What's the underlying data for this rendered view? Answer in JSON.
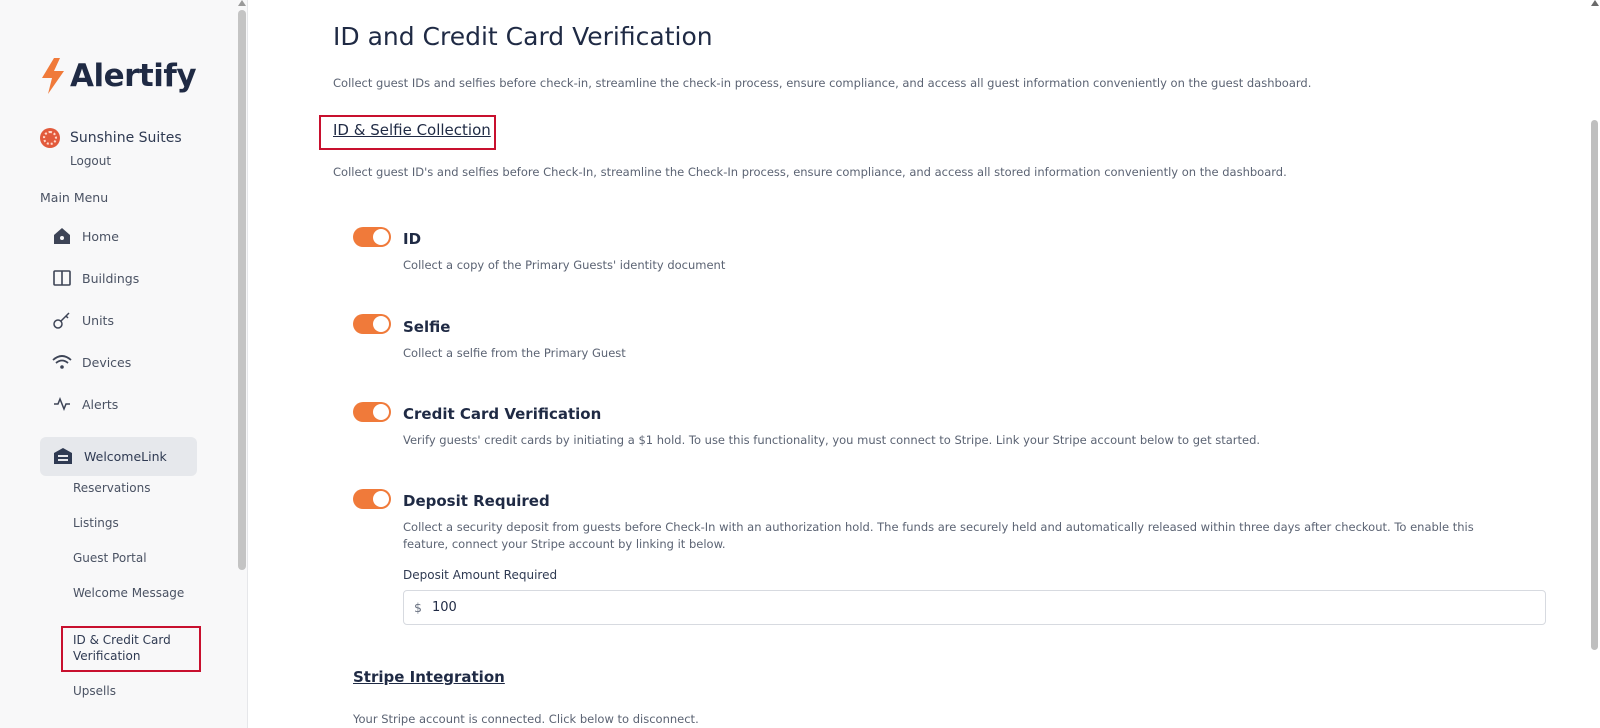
{
  "brand": {
    "name": "Alertify",
    "accent": "#f07a3a",
    "text": "#1f2a44",
    "highlight": "#c8102e"
  },
  "property": {
    "name": "Sunshine Suites",
    "logout": "Logout"
  },
  "sidebar": {
    "menu_title": "Main Menu",
    "items": [
      {
        "label": "Home",
        "icon": "home-icon"
      },
      {
        "label": "Buildings",
        "icon": "book-icon"
      },
      {
        "label": "Units",
        "icon": "key-icon"
      },
      {
        "label": "Devices",
        "icon": "wifi-icon"
      },
      {
        "label": "Alerts",
        "icon": "activity-icon"
      }
    ],
    "active": {
      "label": "WelcomeLink",
      "icon": "building-icon"
    },
    "sub_items": [
      {
        "label": "Reservations"
      },
      {
        "label": "Listings"
      },
      {
        "label": "Guest Portal"
      },
      {
        "label": "Welcome Message"
      },
      {
        "label": "ID & Credit Card Verification"
      },
      {
        "label": "Upsells"
      }
    ]
  },
  "main": {
    "title": "ID and Credit Card Verification",
    "description": "Collect guest IDs and selfies before check-in, streamline the check-in process, ensure compliance, and access all guest information conveniently on the guest dashboard.",
    "section_title": "ID & Selfie Collection",
    "section_description": "Collect guest ID's and selfies before Check-In, streamline the Check-In process, ensure compliance, and access all stored information conveniently on the dashboard.",
    "options": [
      {
        "title": "ID",
        "description": "Collect a copy of the Primary Guests' identity document",
        "enabled": true
      },
      {
        "title": "Selfie",
        "description": "Collect a selfie from the Primary Guest",
        "enabled": true
      },
      {
        "title": "Credit Card Verification",
        "description": "Verify guests' credit cards by initiating a $1 hold. To use this functionality, you must connect to Stripe. Link your Stripe account below to get started.",
        "enabled": true
      },
      {
        "title": "Deposit Required",
        "description": "Collect a security deposit from guests before Check-In with an authorization hold. The funds are securely held and automatically released within three days after checkout. To enable this feature, connect your Stripe account by linking it below.",
        "enabled": true
      }
    ],
    "deposit": {
      "label": "Deposit Amount Required",
      "currency": "$",
      "value": "100"
    },
    "stripe": {
      "title": "Stripe Integration",
      "description": "Your Stripe account is connected. Click below to disconnect."
    }
  }
}
